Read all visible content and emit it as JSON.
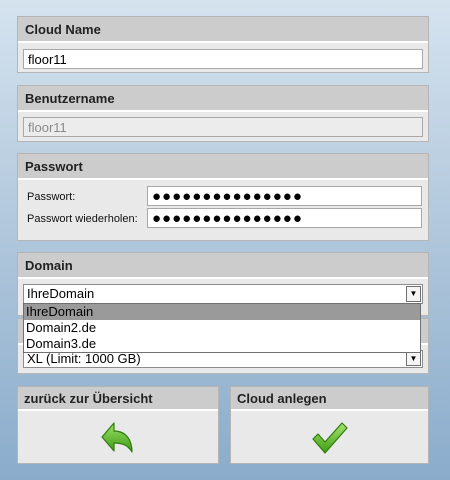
{
  "cloud_name": {
    "heading": "Cloud Name",
    "value": "floor11"
  },
  "username": {
    "heading": "Benutzername",
    "value": "floor11"
  },
  "password": {
    "heading": "Passwort",
    "label": "Passwort:",
    "value": "●●●●●●●●●●●●●●●",
    "repeat_label": "Passwort wiederholen:",
    "repeat_value": "●●●●●●●●●●●●●●●"
  },
  "domain": {
    "heading": "Domain",
    "selected": "IhreDomain",
    "options": [
      "IhreDomain",
      "Domain2.de",
      "Domain3.de"
    ]
  },
  "package": {
    "selected": "XL (Limit: 1000 GB)"
  },
  "buttons": {
    "back_label": "zurück zur Übersicht",
    "create_label": "Cloud anlegen"
  },
  "icons": {
    "back": "green-back-arrow-icon",
    "create": "green-checkmark-icon"
  },
  "colors": {
    "accent_green": "#4caf1e",
    "header_gray": "#cccccc",
    "panel_gray": "#e9e9e9"
  }
}
